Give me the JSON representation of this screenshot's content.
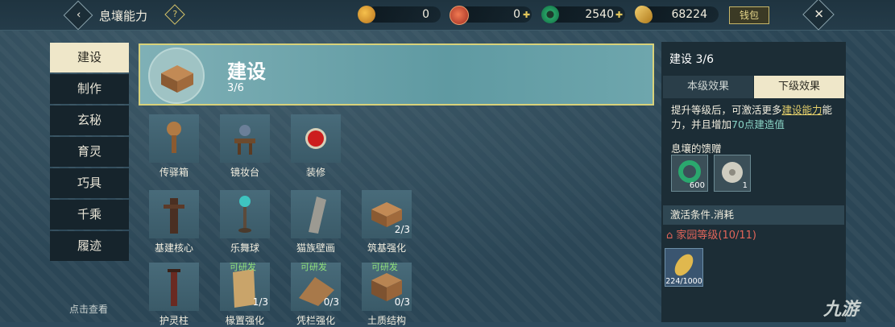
{
  "header": {
    "title": "息壤能力",
    "help_icon": "question-icon",
    "currencies": [
      {
        "icon": "peach-coin-icon",
        "value": "0"
      },
      {
        "icon": "red-spiral-icon",
        "value": "0"
      },
      {
        "icon": "jade-ring-icon",
        "value": "2540"
      },
      {
        "icon": "gold-leaf-icon",
        "value": "68224"
      }
    ],
    "wallet_label": "钱包",
    "close_glyph": "✕",
    "back_glyph": "‹"
  },
  "categories": [
    {
      "label": "建设",
      "active": true
    },
    {
      "label": "制作",
      "active": false
    },
    {
      "label": "玄秘",
      "active": false
    },
    {
      "label": "育灵",
      "active": false
    },
    {
      "label": "巧具",
      "active": false
    },
    {
      "label": "千乘",
      "active": false
    },
    {
      "label": "履迹",
      "active": false
    }
  ],
  "tap_hint": "点击查看",
  "banner": {
    "title": "建设",
    "level": "3/6"
  },
  "items": [
    {
      "name": "传驿箱",
      "count": "",
      "tag": ""
    },
    {
      "name": "镜妆台",
      "count": "",
      "tag": ""
    },
    {
      "name": "装修",
      "count": "",
      "tag": ""
    },
    {
      "name": "基建核心",
      "count": "",
      "tag": ""
    },
    {
      "name": "乐舞球",
      "count": "",
      "tag": ""
    },
    {
      "name": "猫族壁画",
      "count": "",
      "tag": ""
    },
    {
      "name": "筑基强化",
      "count": "2/3",
      "tag": ""
    },
    {
      "name": "护灵柱",
      "count": "",
      "tag": ""
    },
    {
      "name": "椽置强化",
      "count": "1/3",
      "tag": "可研发"
    },
    {
      "name": "凭栏强化",
      "count": "0/3",
      "tag": "可研发"
    },
    {
      "name": "土质结构",
      "count": "0/3",
      "tag": "可研发"
    }
  ],
  "right_panel": {
    "title": "建设 3/6",
    "tabs": [
      "本级效果",
      "下级效果"
    ],
    "desc_prefix": "提升等级后，可激活更多",
    "desc_link": "建设能力",
    "desc_mid": "能力，并且增加",
    "desc_value": "70点建造值",
    "rewards_label": "息壤的馈赠",
    "rewards": [
      {
        "icon": "jade-ring-icon",
        "count": "600"
      },
      {
        "icon": "jade-disc-icon",
        "count": "1"
      }
    ],
    "conditions_label": "激活条件.消耗",
    "condition": "家园等级(10/11)",
    "cost": {
      "icon": "gold-leaf-icon",
      "count": "224/1000"
    }
  },
  "watermark": "九游"
}
